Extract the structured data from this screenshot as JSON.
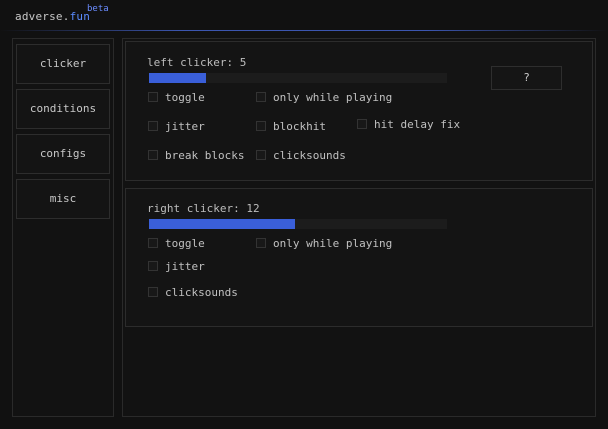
{
  "header": {
    "brand_main": "adverse.",
    "brand_accent": "fun",
    "badge": "beta"
  },
  "sidebar": {
    "items": [
      {
        "label": "clicker"
      },
      {
        "label": "conditions"
      },
      {
        "label": "configs"
      },
      {
        "label": "misc"
      }
    ]
  },
  "left_clicker": {
    "title": "left clicker: 5",
    "value": 5,
    "slider_fill_fraction": 0.19,
    "help_label": "?",
    "options": {
      "toggle": "toggle",
      "only_while_playing": "only while playing",
      "jitter": "jitter",
      "blockhit": "blockhit",
      "hit_delay_fix": "hit delay fix",
      "break_blocks": "break blocks",
      "clicksounds": "clicksounds"
    }
  },
  "right_clicker": {
    "title": "right clicker: 12",
    "value": 12,
    "slider_fill_fraction": 0.49,
    "options": {
      "toggle": "toggle",
      "only_while_playing": "only while playing",
      "jitter": "jitter",
      "clicksounds": "clicksounds"
    }
  },
  "colors": {
    "accent": "#3a5fd9",
    "background": "#111111",
    "text": "#c8c8c8"
  }
}
